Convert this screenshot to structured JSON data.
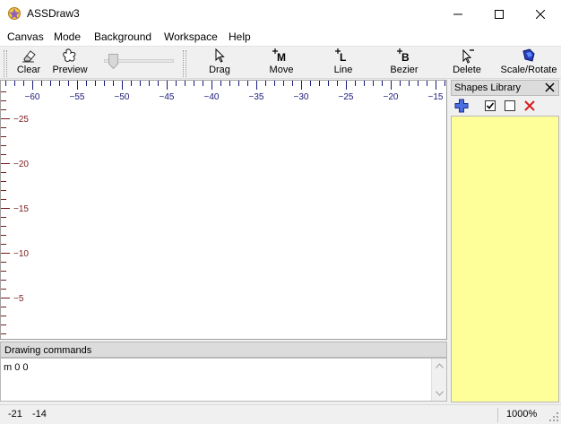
{
  "window": {
    "title": "ASSDraw3"
  },
  "menu": [
    "Canvas",
    "Mode",
    "Background",
    "Workspace",
    "Help"
  ],
  "toolbar": {
    "clear": "Clear",
    "preview": "Preview",
    "drag": "Drag",
    "move": "Move",
    "line": "Line",
    "bezier": "Bezier",
    "delete": "Delete",
    "scale_rotate": "Scale/Rotate"
  },
  "ruler": {
    "x_labels": [
      "−60",
      "−55",
      "−50",
      "−45",
      "−40",
      "−35",
      "−30",
      "−25",
      "−20",
      "−15"
    ],
    "y_labels": [
      "−25",
      "−20",
      "−15",
      "−10",
      "−5"
    ],
    "x_color": "#1a1a7a",
    "y_color": "#7a1a1a"
  },
  "commands": {
    "header": "Drawing commands",
    "text": "m 0 0"
  },
  "library": {
    "header": "Shapes Library",
    "panel_color": "#ffff99"
  },
  "status": {
    "x": "-21",
    "y": "-14",
    "zoom": "1000%"
  }
}
